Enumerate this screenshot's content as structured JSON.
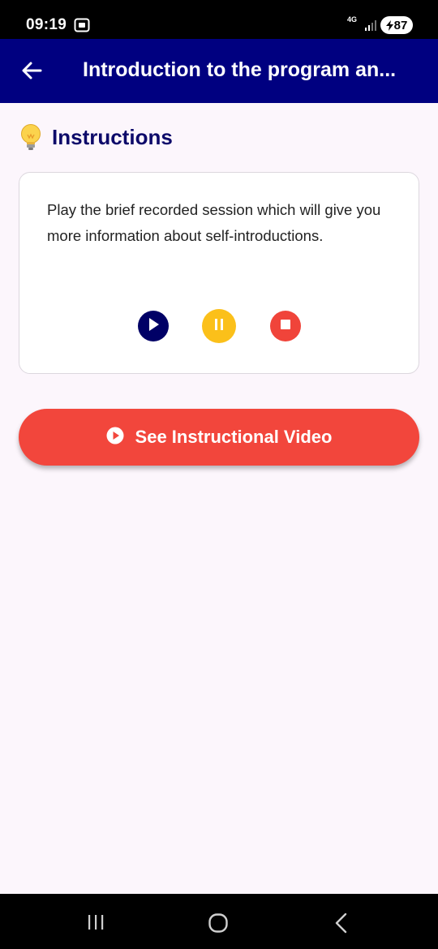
{
  "status_bar": {
    "time": "09:19",
    "network": "4G",
    "battery": "87",
    "icons": [
      "screen-record-icon",
      "signal-icon",
      "charging-icon"
    ]
  },
  "app_bar": {
    "title": "Introduction to the program an...",
    "back_icon": "arrow-left-icon",
    "background": "#000080"
  },
  "instructions": {
    "icon": "lightbulb-icon",
    "heading": "Instructions",
    "text": "Play the brief recorded session which will give you more information about self-introductions.",
    "controls": [
      {
        "name": "play",
        "icon": "play-icon",
        "color": "#000066"
      },
      {
        "name": "pause",
        "icon": "pause-icon",
        "color": "#fbc01a"
      },
      {
        "name": "stop",
        "icon": "stop-icon",
        "color": "#f0443a"
      }
    ]
  },
  "video_button": {
    "label": "See Instructional Video",
    "icon": "play-circle-icon",
    "color": "#f2463c"
  },
  "nav_bar": {
    "icons": [
      "recents-icon",
      "home-icon",
      "back-icon"
    ]
  }
}
